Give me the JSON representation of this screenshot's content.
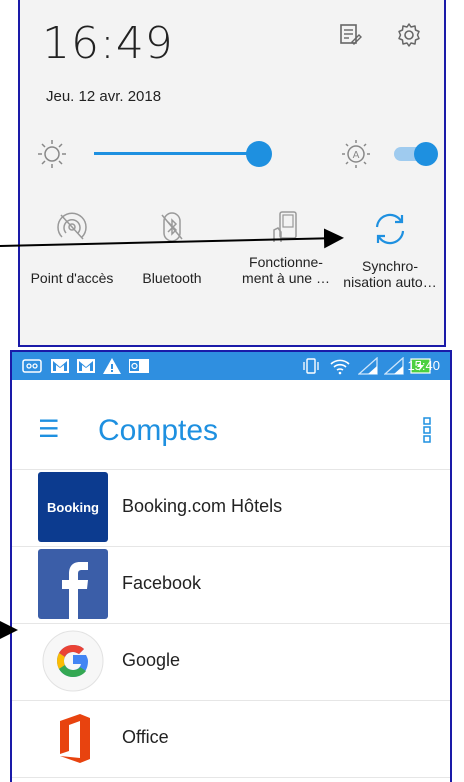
{
  "quick_settings": {
    "time": "16:49",
    "date": "Jeu. 12 avr. 2018",
    "brightness_level": 0.88,
    "auto_brightness_on": true,
    "tiles": [
      {
        "id": "hotspot",
        "label": "Point d'accès",
        "icon": "hotspot-off-icon"
      },
      {
        "id": "bluetooth",
        "label": "Bluetooth",
        "icon": "bluetooth-off-icon"
      },
      {
        "id": "fonctionnement",
        "label": "Fonctionne-\nment à une …",
        "icon": "one-hand-phone-icon"
      },
      {
        "id": "sync",
        "label": "Synchro-\nnisation auto…",
        "icon": "sync-icon"
      }
    ],
    "accent": "#1e90e0"
  },
  "accounts": {
    "status_time": "15:40",
    "title": "Comptes",
    "items": [
      {
        "name": "Booking.com Hôtels",
        "icon_text": "Booking",
        "icon": "booking-icon"
      },
      {
        "name": "Facebook",
        "icon": "facebook-icon"
      },
      {
        "name": "Google",
        "icon": "google-icon"
      },
      {
        "name": "Office",
        "icon": "office-icon"
      }
    ],
    "accent": "#1e90e0",
    "statusbar_color": "#2f8fe0"
  }
}
